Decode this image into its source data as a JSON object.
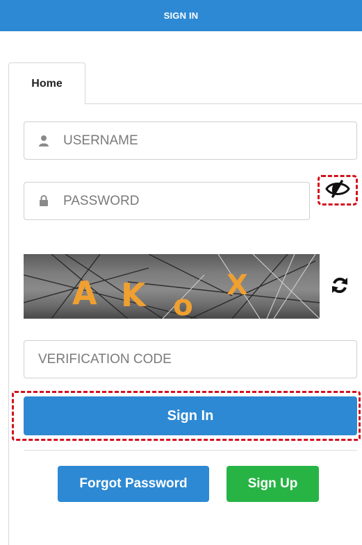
{
  "header": {
    "title": "SIGN IN"
  },
  "tabs": [
    {
      "label": "Home"
    }
  ],
  "form": {
    "username_placeholder": "USERNAME",
    "password_placeholder": "PASSWORD",
    "verification_placeholder": "VERIFICATION CODE",
    "captcha_text": [
      "A",
      "K",
      "o",
      "X"
    ]
  },
  "buttons": {
    "sign_in": "Sign In",
    "forgot_password": "Forgot Password",
    "sign_up": "Sign Up"
  },
  "icons": {
    "username": "user-icon",
    "password": "lock-icon",
    "toggle": "eye-slash-icon",
    "refresh": "refresh-icon"
  },
  "colors": {
    "primary": "#2d89d3",
    "success": "#27b445",
    "highlight": "#d4101c",
    "captcha_glyph": "#f0a030"
  }
}
